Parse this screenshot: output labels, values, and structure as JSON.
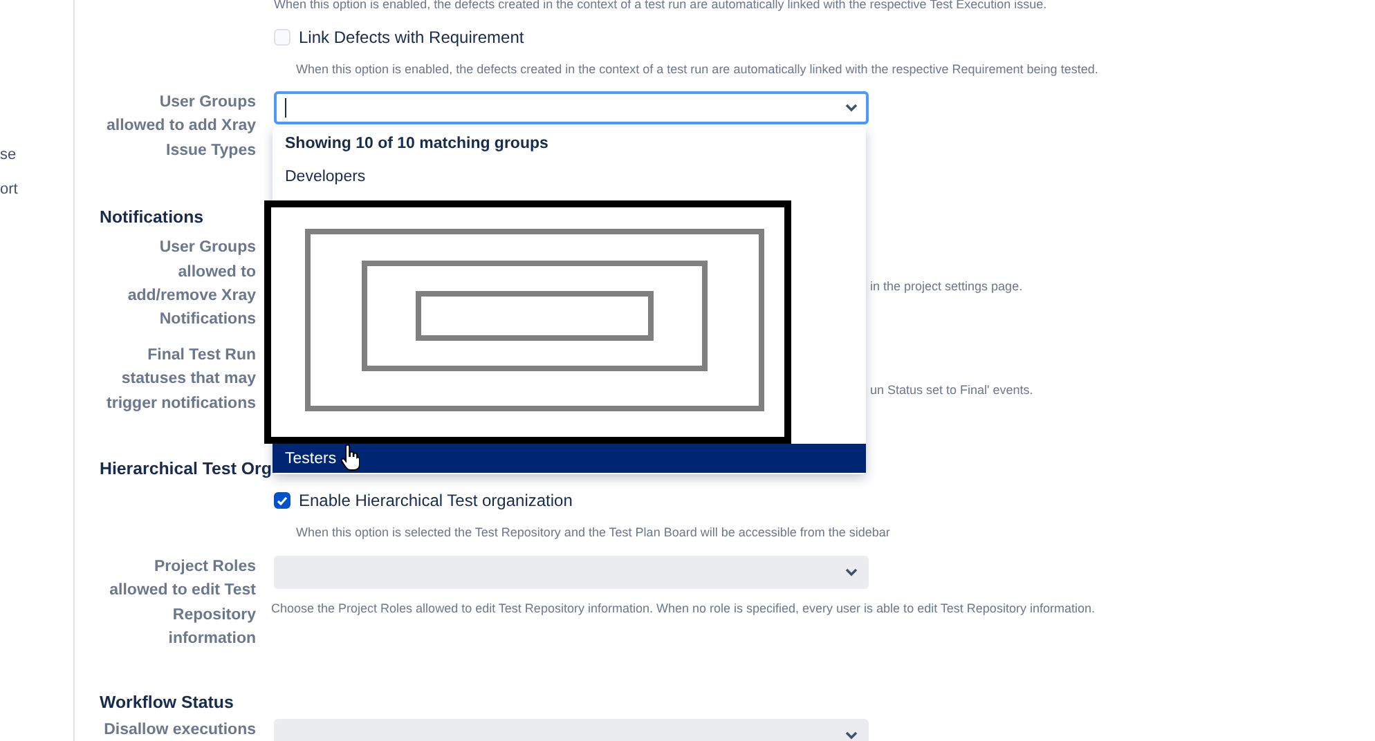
{
  "sidebar": {
    "items": [
      {
        "label": "se"
      },
      {
        "label": "ort"
      }
    ]
  },
  "sections": [
    {
      "rows": [
        {
          "kind": "note",
          "description": "When this option is enabled, the defects created in the context of a test run are automatically linked with the respective Test Execution issue."
        },
        {
          "kind": "checkbox",
          "label": "Link Defects with Requirement",
          "checked": false,
          "description": "When this option is enabled, the defects created in the context of a test run are automatically linked with the respective Requirement being tested."
        },
        {
          "kind": "select",
          "label": "User Groups allowed to add Xray Issue Types",
          "focused": true,
          "dropdown": {
            "header": "Showing 10 of 10 matching groups",
            "items": [
              {
                "label": "Developers",
                "selected": false
              },
              {
                "label": "Testers",
                "selected": true
              }
            ]
          }
        }
      ]
    },
    {
      "heading": "Notifications",
      "rows": [
        {
          "kind": "covered",
          "label": "User Groups allowed to add/remove Xray Notifications",
          "description": "in the project settings page."
        },
        {
          "kind": "covered",
          "label": "Final Test Run statuses that may trigger notifications",
          "description": "un Status set to Final' events."
        }
      ]
    },
    {
      "heading": "Hierarchical Test Org",
      "rows": [
        {
          "kind": "checkbox",
          "label": "Enable Hierarchical Test organization",
          "checked": true,
          "description": "When this option is selected the Test Repository and the Test Plan Board will be accessible from the sidebar"
        },
        {
          "kind": "select",
          "label": "Project Roles allowed to edit Test Repository information",
          "focused": false,
          "description": "Choose the Project Roles allowed to edit Test Repository information. When no role is specified, every user is able to edit Test Repository information."
        }
      ]
    },
    {
      "heading": "Workflow Status",
      "rows": [
        {
          "kind": "select",
          "label": "Disallow executions",
          "focused": false
        }
      ]
    }
  ]
}
